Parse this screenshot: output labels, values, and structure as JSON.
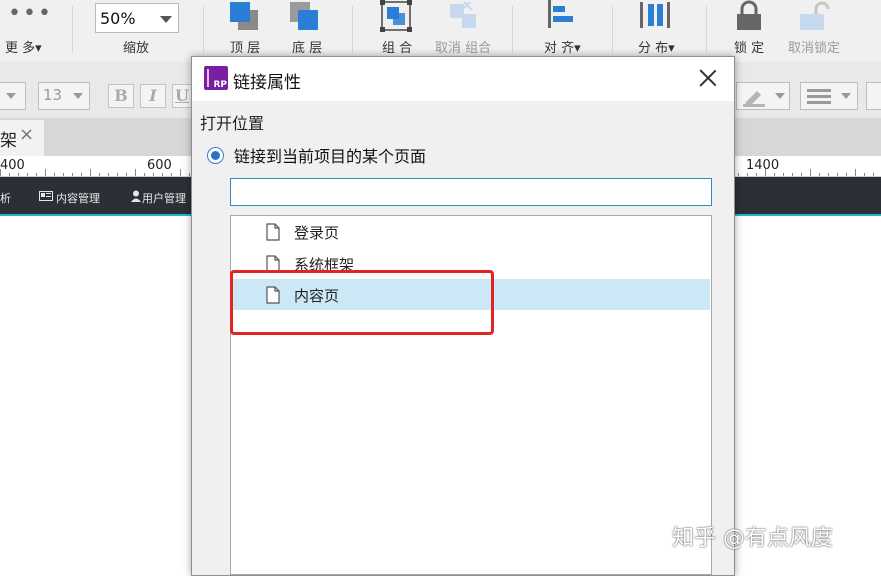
{
  "toolbar": {
    "more_label": "更 多▾",
    "zoom_value": "50%",
    "zoom_label": "缩放",
    "bring_front_label": "顶 层",
    "send_back_label": "底 层",
    "group_label": "组 合",
    "ungroup_label": "取消 组合",
    "align_label": "对 齐▾",
    "distribute_label": "分 布▾",
    "lock_label": "锁 定",
    "unlock_label": "取消锁定"
  },
  "formatbar": {
    "font_size_value": "13",
    "bold": "B",
    "italic": "I",
    "underline": "U"
  },
  "tab": {
    "label": "架",
    "close": "×"
  },
  "ruler": {
    "labels": [
      "400",
      "600",
      "1400"
    ]
  },
  "canvas_nav": {
    "item_partial": "析",
    "content_manage": "内容管理",
    "user_manage": "用户管理"
  },
  "dialog": {
    "title": "链接属性",
    "section_label": "打开位置",
    "radio_label": "链接到当前项目的某个页面",
    "search_value": "",
    "pages": [
      "登录页",
      "系统框架",
      "内容页"
    ],
    "selected_page": "内容页"
  },
  "watermark": "知乎 @有点风度",
  "colors": {
    "accent": "#2a72c4",
    "selection": "#cce8f6",
    "highlight": "#e02424",
    "toolbar_blue": "#2a7fd4",
    "nav_bg": "#2b3037"
  }
}
